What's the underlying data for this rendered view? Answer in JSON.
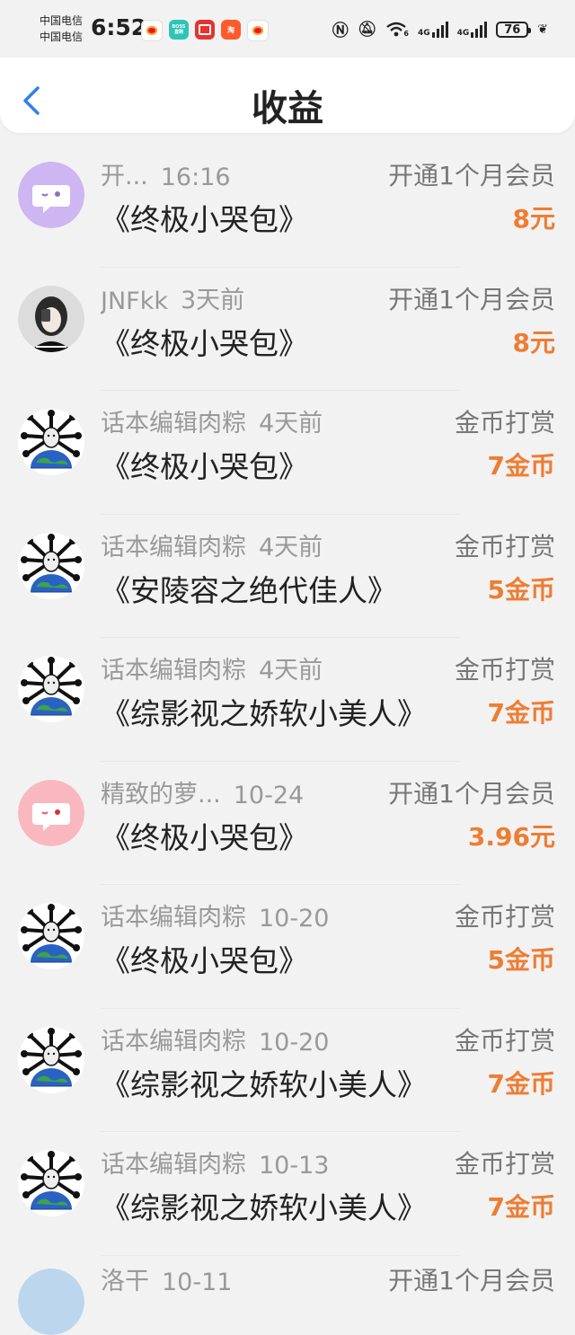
{
  "status_bar": {
    "carrier_1": "中国电信",
    "carrier_2": "中国电信",
    "time": "6:52",
    "battery": "76",
    "network_1": "4G",
    "network_2": "4G",
    "wifi_label": "6",
    "boss_icon_label": "BOSS 直聘"
  },
  "header": {
    "title": "收益",
    "back_icon": "chevron-left-icon"
  },
  "records": [
    {
      "user": "开...",
      "time": "16:16",
      "book": "《终极小哭包》",
      "type": "开通1个月会员",
      "amount": "8元",
      "avatar": "chat-bubble-purple"
    },
    {
      "user": "JNFkk",
      "time": "3天前",
      "book": "《终极小哭包》",
      "type": "开通1个月会员",
      "amount": "8元",
      "avatar": "photo-person"
    },
    {
      "user": "话本编辑肉粽",
      "time": "4天前",
      "book": "《终极小哭包》",
      "type": "金币打赏",
      "amount": "7金币",
      "avatar": "earth-bones"
    },
    {
      "user": "话本编辑肉粽",
      "time": "4天前",
      "book": "《安陵容之绝代佳人》",
      "type": "金币打赏",
      "amount": "5金币",
      "avatar": "earth-bones"
    },
    {
      "user": "话本编辑肉粽",
      "time": "4天前",
      "book": "《综影视之娇软小美人》",
      "type": "金币打赏",
      "amount": "7金币",
      "avatar": "earth-bones"
    },
    {
      "user": "精致的萝...",
      "time": "10-24",
      "book": "《终极小哭包》",
      "type": "开通1个月会员",
      "amount": "3.96元",
      "avatar": "chat-bubble-pink"
    },
    {
      "user": "话本编辑肉粽",
      "time": "10-20",
      "book": "《终极小哭包》",
      "type": "金币打赏",
      "amount": "5金币",
      "avatar": "earth-bones"
    },
    {
      "user": "话本编辑肉粽",
      "time": "10-20",
      "book": "《综影视之娇软小美人》",
      "type": "金币打赏",
      "amount": "7金币",
      "avatar": "earth-bones"
    },
    {
      "user": "话本编辑肉粽",
      "time": "10-13",
      "book": "《综影视之娇软小美人》",
      "type": "金币打赏",
      "amount": "7金币",
      "avatar": "earth-bones"
    }
  ],
  "partial_record": {
    "user": "洛干",
    "time": "10-11",
    "type": "开通1个月会员"
  },
  "colors": {
    "accent": "#2f80ed",
    "amount": "#ee7d33",
    "secondary_text": "#999999"
  }
}
